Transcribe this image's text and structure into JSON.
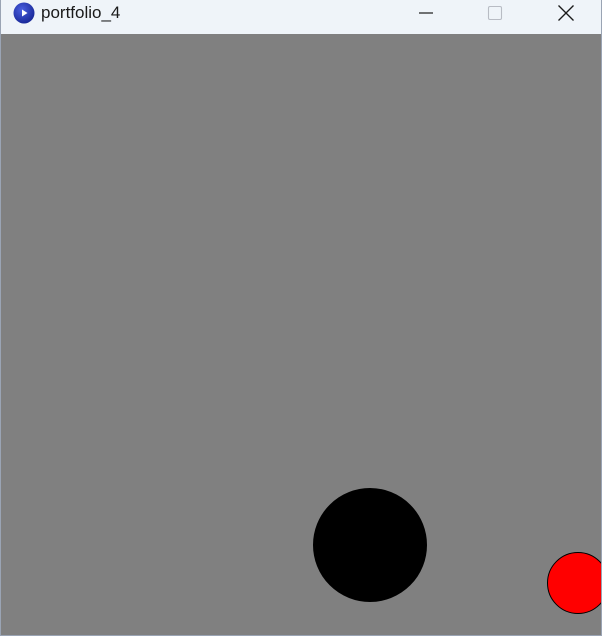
{
  "window": {
    "title": "portfolio_4",
    "app_icon": "processing-app-icon",
    "title_bar_color": "#eff4f9"
  },
  "controls": {
    "minimize_icon": "minimize-icon",
    "maximize_icon": "maximize-icon",
    "close_icon": "close-icon"
  },
  "sketch": {
    "background_color": "#808080",
    "shapes": [
      {
        "name": "black-circle",
        "fill": "#000000"
      },
      {
        "name": "red-circle",
        "fill": "#ff0000"
      }
    ]
  }
}
